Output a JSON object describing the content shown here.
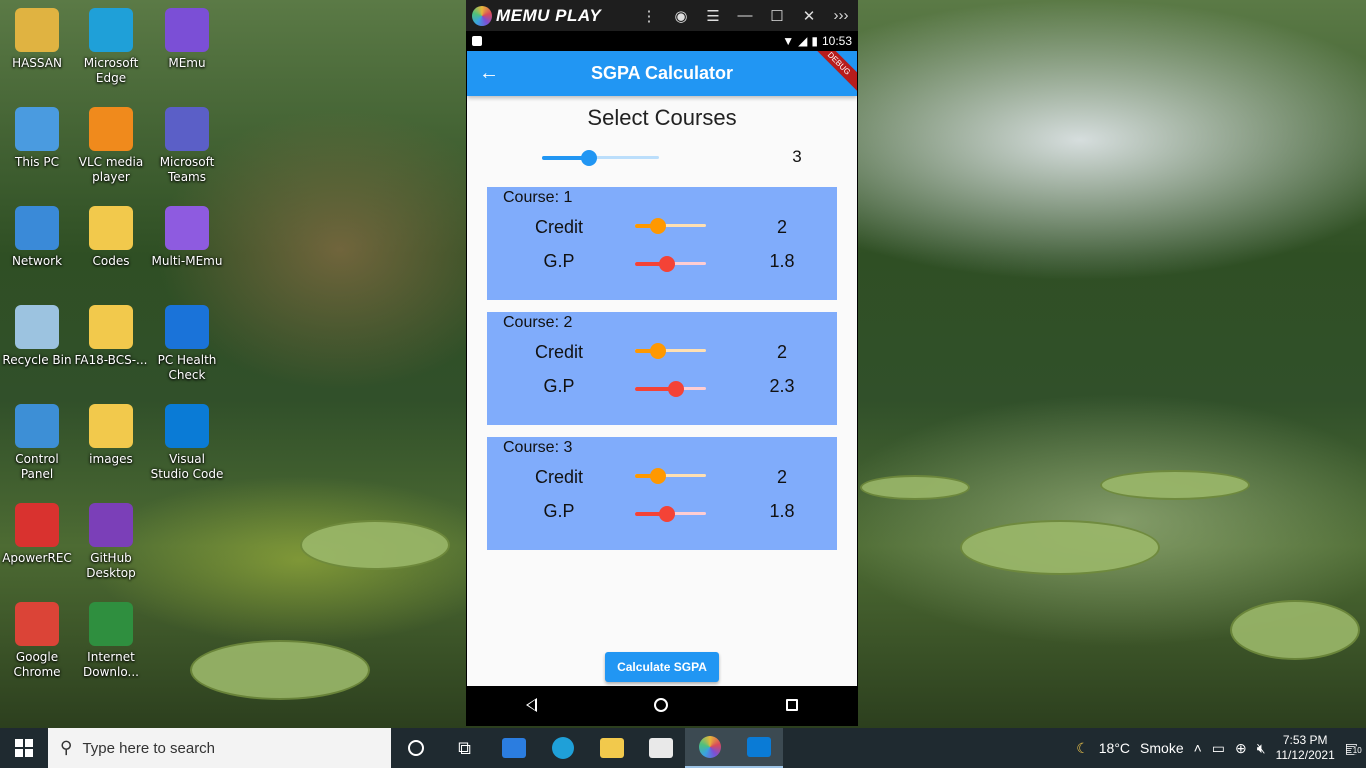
{
  "desktop": {
    "icons": [
      {
        "label": "HASSAN",
        "icon": "user-folder-icon",
        "color": "#e0b341"
      },
      {
        "label": "Microsoft Edge",
        "icon": "edge-icon",
        "color": "#1fa0d8"
      },
      {
        "label": "MEmu",
        "icon": "memu-icon",
        "color": "#7b4fd6"
      },
      {
        "label": "This PC",
        "icon": "computer-icon",
        "color": "#4a9be0"
      },
      {
        "label": "VLC media player",
        "icon": "vlc-icon",
        "color": "#f08a1c"
      },
      {
        "label": "Microsoft Teams",
        "icon": "teams-icon",
        "color": "#5b5fc7"
      },
      {
        "label": "Network",
        "icon": "network-icon",
        "color": "#3a8ad8"
      },
      {
        "label": "Codes",
        "icon": "folder-icon",
        "color": "#f2c94c"
      },
      {
        "label": "Multi-MEmu",
        "icon": "multi-memu-icon",
        "color": "#8e5be0"
      },
      {
        "label": "Recycle Bin",
        "icon": "recycle-bin-icon",
        "color": "#9cc3e0"
      },
      {
        "label": "FA18-BCS-...",
        "icon": "folder-icon",
        "color": "#f2c94c"
      },
      {
        "label": "PC Health Check",
        "icon": "health-check-icon",
        "color": "#1a73d9"
      },
      {
        "label": "Control Panel",
        "icon": "control-panel-icon",
        "color": "#3d8fd6"
      },
      {
        "label": "images",
        "icon": "folder-icon",
        "color": "#f2c94c"
      },
      {
        "label": "Visual Studio Code",
        "icon": "vscode-icon",
        "color": "#0a7bd6"
      },
      {
        "label": "ApowerREC",
        "icon": "apowerrec-icon",
        "color": "#d9322f"
      },
      {
        "label": "GitHub Desktop",
        "icon": "github-icon",
        "color": "#7b3fb8"
      },
      {
        "label": "Google Chrome",
        "icon": "chrome-icon",
        "color": "#db4437"
      },
      {
        "label": "Internet Downlo...",
        "icon": "idm-icon",
        "color": "#2f8f3f"
      }
    ]
  },
  "emulator": {
    "title": "MEMU PLAY",
    "controls": [
      "⋮",
      "◉",
      "☰",
      "—",
      "☐",
      "✕",
      "›››"
    ],
    "status_time": "10:53",
    "debug_label": "DEBUG"
  },
  "app": {
    "title": "SGPA Calculator",
    "back_icon": "←",
    "select_title": "Select Courses",
    "course_count": {
      "value": "3",
      "fraction": 0.4
    },
    "courses": [
      {
        "label": "Course: 1",
        "credit_label": "Credit",
        "credit_value": "2",
        "credit_fraction": 0.33,
        "gp_label": "G.P",
        "gp_value": "1.8",
        "gp_fraction": 0.45
      },
      {
        "label": "Course: 2",
        "credit_label": "Credit",
        "credit_value": "2",
        "credit_fraction": 0.33,
        "gp_label": "G.P",
        "gp_value": "2.3",
        "gp_fraction": 0.575
      },
      {
        "label": "Course: 3",
        "credit_label": "Credit",
        "credit_value": "2",
        "credit_fraction": 0.33,
        "gp_label": "G.P",
        "gp_value": "1.8",
        "gp_fraction": 0.45
      }
    ],
    "calculate_button": "Calculate SGPA"
  },
  "taskbar": {
    "search_placeholder": "Type here to search",
    "apps": [
      "task-view-icon",
      "mail-icon",
      "edge-icon",
      "file-explorer-icon",
      "store-icon",
      "memu-icon",
      "vscode-icon"
    ],
    "weather_temp": "18°C",
    "weather_desc": "Smoke",
    "time": "7:53 PM",
    "date": "11/12/2021",
    "notifications": "10"
  }
}
